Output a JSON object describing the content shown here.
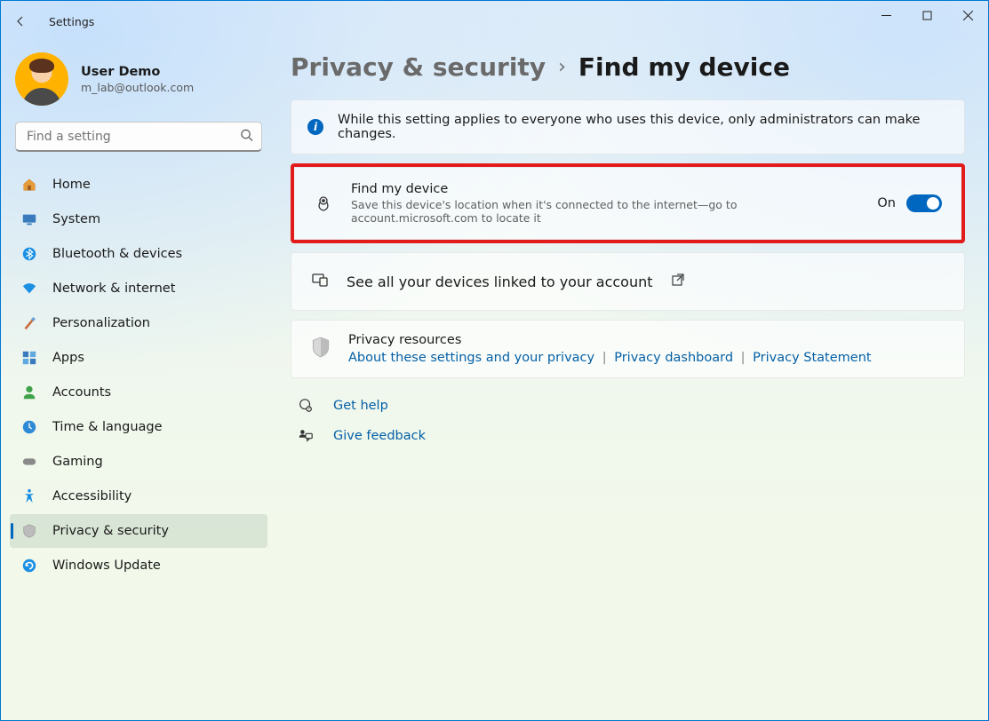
{
  "window": {
    "title": "Settings"
  },
  "profile": {
    "name": "User Demo",
    "email": "m_lab@outlook.com"
  },
  "search": {
    "placeholder": "Find a setting"
  },
  "sidebar": {
    "items": [
      {
        "label": "Home"
      },
      {
        "label": "System"
      },
      {
        "label": "Bluetooth & devices"
      },
      {
        "label": "Network & internet"
      },
      {
        "label": "Personalization"
      },
      {
        "label": "Apps"
      },
      {
        "label": "Accounts"
      },
      {
        "label": "Time & language"
      },
      {
        "label": "Gaming"
      },
      {
        "label": "Accessibility"
      },
      {
        "label": "Privacy & security"
      },
      {
        "label": "Windows Update"
      }
    ]
  },
  "breadcrumb": {
    "parent": "Privacy & security",
    "current": "Find my device"
  },
  "info_banner": "While this setting applies to everyone who uses this device, only administrators can make changes.",
  "find_my_device": {
    "title": "Find my device",
    "description": "Save this device's location when it's connected to the internet—go to account.microsoft.com to locate it",
    "state_label": "On"
  },
  "devices_link": {
    "label": "See all your devices linked to your account"
  },
  "privacy_resources": {
    "title": "Privacy resources",
    "links": {
      "about": "About these settings and your privacy",
      "dashboard": "Privacy dashboard",
      "statement": "Privacy Statement"
    }
  },
  "help": {
    "get_help": "Get help",
    "feedback": "Give feedback"
  }
}
